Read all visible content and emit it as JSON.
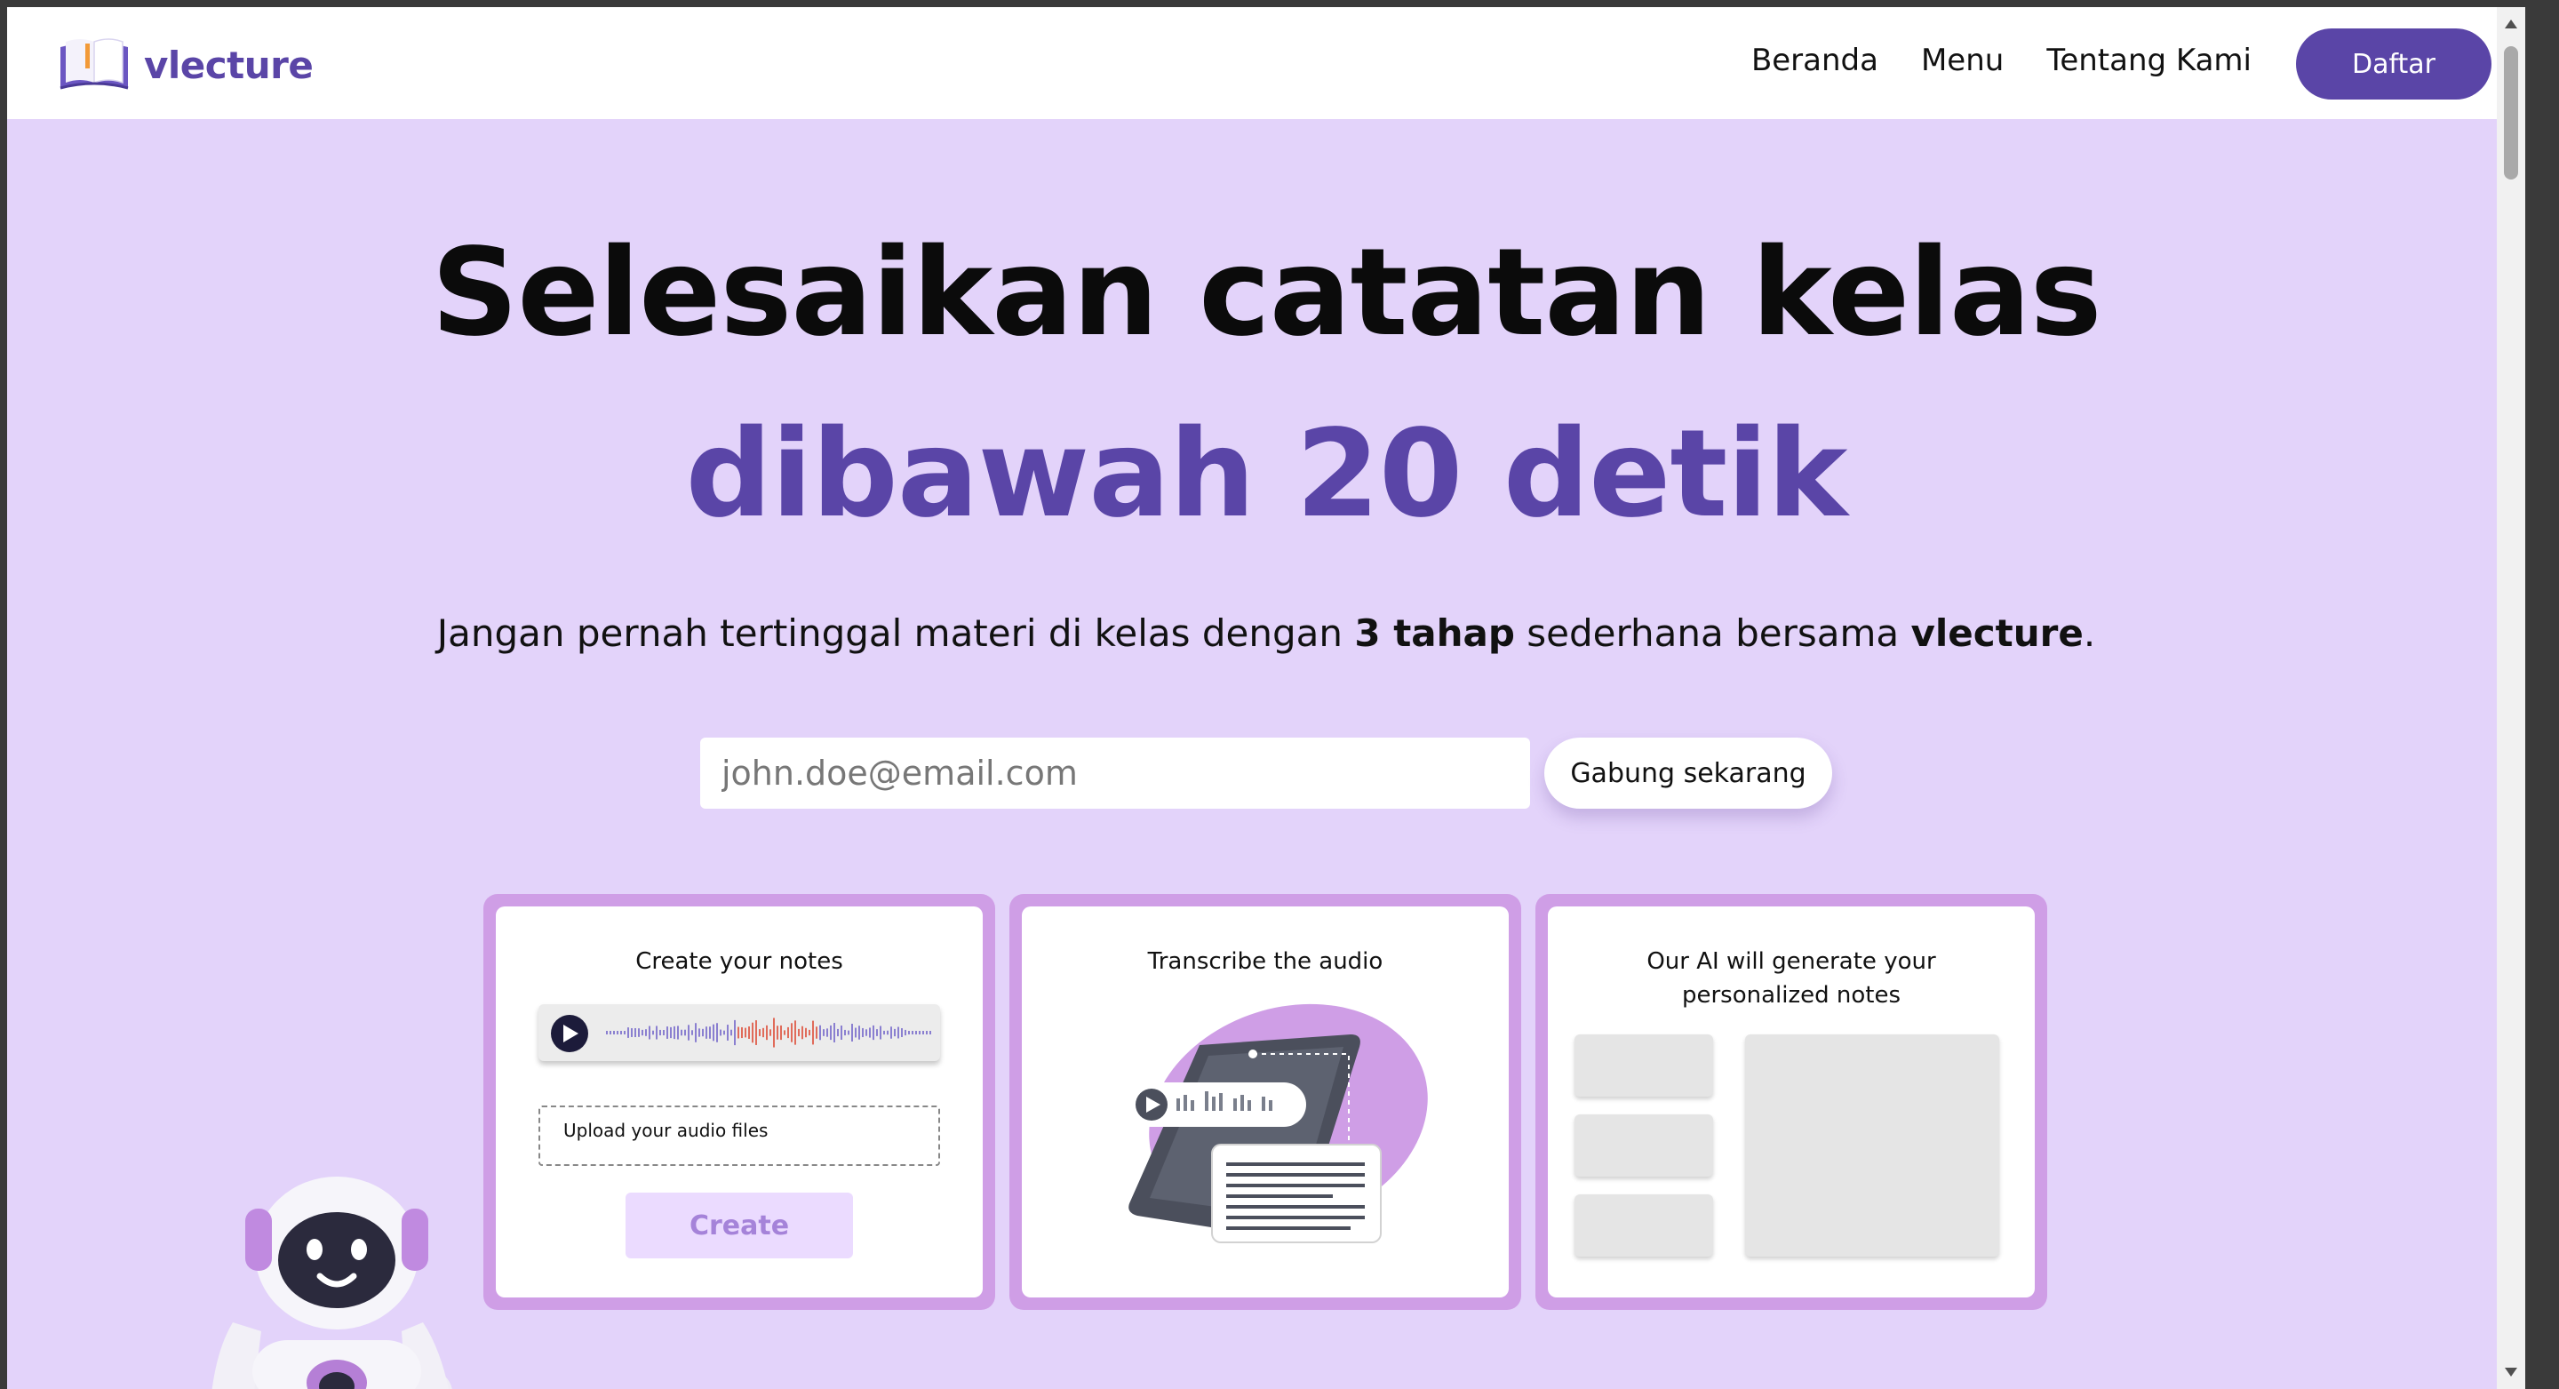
{
  "nav": {
    "brand": "vlecture",
    "links": [
      "Beranda",
      "Menu",
      "Tentang Kami"
    ],
    "cta": "Daftar"
  },
  "hero": {
    "title_line1": "Selesaikan catatan kelas",
    "title_line2": "dibawah 20 detik",
    "subtitle": {
      "part1": "Jangan pernah tertinggal materi di kelas dengan ",
      "bold1": "3 tahap",
      "part2": " sederhana bersama ",
      "bold2": "vlecture",
      "part3": "."
    },
    "email_placeholder": "john.doe@email.com",
    "join_button": "Gabung sekarang"
  },
  "cards": [
    {
      "title": "Create your notes",
      "upload_label": "Upload your audio files",
      "create_button": "Create"
    },
    {
      "title": "Transcribe the audio"
    },
    {
      "title_line1": "Our AI will generate your",
      "title_line2": "personalized notes"
    }
  ],
  "colors": {
    "brand": "#5a45a7",
    "hero_bg": "#e3d3fa",
    "card_border": "#cf9ee6",
    "create_bg": "#ebdbff",
    "create_text": "#a583d9"
  },
  "icons": [
    "book-logo-icon",
    "play-icon",
    "waveform-icon",
    "robot-mascot"
  ]
}
